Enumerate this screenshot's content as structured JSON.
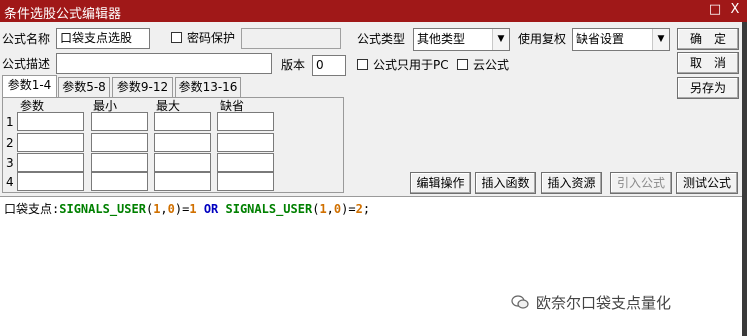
{
  "window": {
    "title": "条件选股公式编辑器",
    "close_glyph": "□",
    "x_glyph": "X"
  },
  "form": {
    "name_label": "公式名称",
    "name_value": "口袋支点选股",
    "password_label": "密码保护",
    "password_value": "",
    "type_label": "公式类型",
    "type_value": "其他类型",
    "restore_label": "使用复权",
    "restore_value": "缺省设置",
    "desc_label": "公式描述",
    "desc_value": "",
    "version_label": "版本",
    "version_value": "0",
    "pc_only_label": "公式只用于PC",
    "cloud_label": "云公式"
  },
  "buttons": {
    "ok": "确　定",
    "cancel": "取　消",
    "save_as": "另存为",
    "edit_ops": "编辑操作",
    "insert_func": "插入函数",
    "insert_res": "插入资源",
    "import_formula": "引入公式",
    "test_formula": "测试公式"
  },
  "tabs": [
    "参数1-4",
    "参数5-8",
    "参数9-12",
    "参数13-16"
  ],
  "params": {
    "headers": [
      "参数",
      "最小",
      "最大",
      "缺省"
    ],
    "rows": [
      "1",
      "2",
      "3",
      "4"
    ]
  },
  "code": {
    "name": "口袋支点",
    "colon": ":",
    "fn1": "SIGNALS_USER",
    "p_open": "(",
    "n1": "1",
    "comma": ",",
    "n0": "0",
    "p_close": ")",
    "eq1": "=",
    "v1": "1",
    "or": " OR ",
    "fn2": "SIGNALS_USER",
    "eq2": "=",
    "v2": "2",
    "semi": ";"
  },
  "watermark": "欧奈尔口袋支点量化"
}
